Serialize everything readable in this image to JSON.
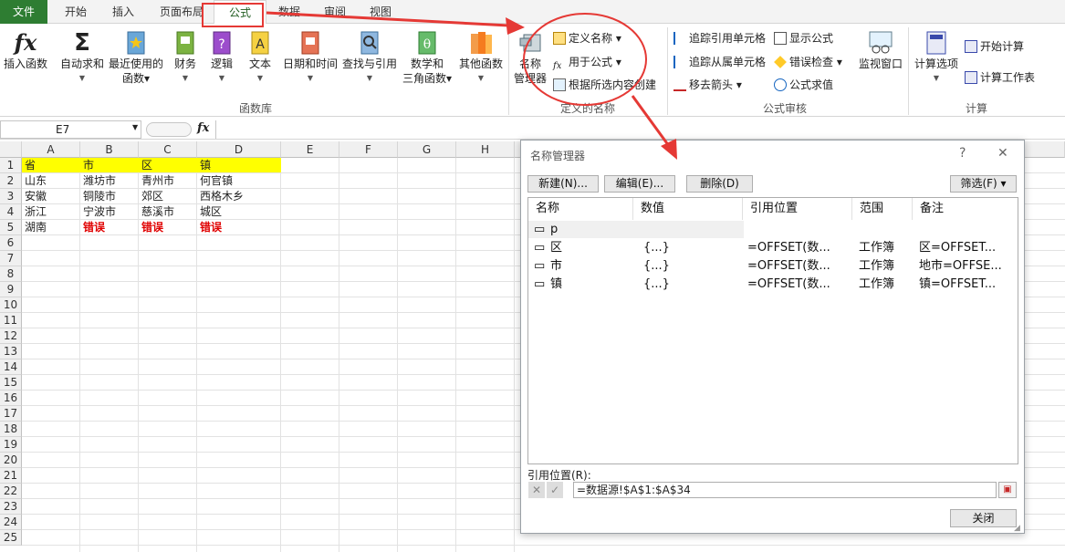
{
  "tabs": [
    "文件",
    "开始",
    "插入",
    "页面布局",
    "公式",
    "数据",
    "审阅",
    "视图"
  ],
  "ribbon": {
    "insert_function": "插入函数",
    "autosum": "自动求和",
    "recent": [
      "最近使用的",
      "函数"
    ],
    "finance": "财务",
    "logic": "逻辑",
    "text": "文本",
    "datetime": "日期和时间",
    "lookup": "查找与引用",
    "math": [
      "数学和",
      "三角函数"
    ],
    "other": "其他函数",
    "group_funclib": "函数库",
    "name_manager": [
      "名称",
      "管理器"
    ],
    "define_name": "定义名称",
    "use_in_formula": "用于公式",
    "create_from_sel": "根据所选内容创建",
    "group_names": "定义的名称",
    "trace_prec": "追踪引用单元格",
    "trace_dep": "追踪从属单元格",
    "remove_arrows": "移去箭头",
    "show_formulas": "显示公式",
    "error_check": "错误检查",
    "eval_formula": "公式求值",
    "group_audit": "公式审核",
    "watch": "监视窗口",
    "calc_options": "计算选项",
    "calc_now": "开始计算",
    "calc_sheet": "计算工作表",
    "group_calc": "计算"
  },
  "formula_bar": {
    "name_box": "E7",
    "fx": "fx"
  },
  "sheet": {
    "columns": [
      "A",
      "B",
      "C",
      "D",
      "E",
      "F",
      "G",
      "H"
    ],
    "rows": [
      "1",
      "2",
      "3",
      "4",
      "5",
      "6",
      "7",
      "8",
      "9",
      "10",
      "11",
      "12",
      "13",
      "14",
      "15",
      "16",
      "17",
      "18",
      "19",
      "20",
      "21",
      "22",
      "23",
      "24",
      "25"
    ],
    "header": [
      "省",
      "市",
      "区",
      "镇"
    ],
    "data": [
      [
        "山东",
        "潍坊市",
        "青州市",
        "何官镇"
      ],
      [
        "安徽",
        "铜陵市",
        "郊区",
        "西格木乡"
      ],
      [
        "浙江",
        "宁波市",
        "慈溪市",
        "城区"
      ],
      [
        "湖南",
        "错误",
        "错误",
        "错误"
      ]
    ]
  },
  "dialog": {
    "title": "名称管理器",
    "help": "?",
    "close": "✕",
    "new": "新建(N)...",
    "edit": "编辑(E)...",
    "delete": "删除(D)",
    "filter": "筛选(F)",
    "cols": [
      "名称",
      "数值",
      "引用位置",
      "范围",
      "备注"
    ],
    "items": [
      {
        "name": "p",
        "value": "",
        "ref": "",
        "scope": "",
        "note": ""
      },
      {
        "name": "区",
        "value": "{...}",
        "ref": "=OFFSET(数...",
        "scope": "工作簿",
        "note": "区=OFFSET..."
      },
      {
        "name": "市",
        "value": "{...}",
        "ref": "=OFFSET(数...",
        "scope": "工作簿",
        "note": "地市=OFFSE..."
      },
      {
        "name": "镇",
        "value": "{...}",
        "ref": "=OFFSET(数...",
        "scope": "工作簿",
        "note": "镇=OFFSET..."
      }
    ],
    "ref_label": "引用位置(R):",
    "ref_value": "=数据源!$A$1:$A$34",
    "close_btn": "关闭"
  },
  "colors": {
    "accent": "#2e7d32",
    "highlight": "#ffff00",
    "error": "#e00000",
    "annotation": "#e53935"
  }
}
